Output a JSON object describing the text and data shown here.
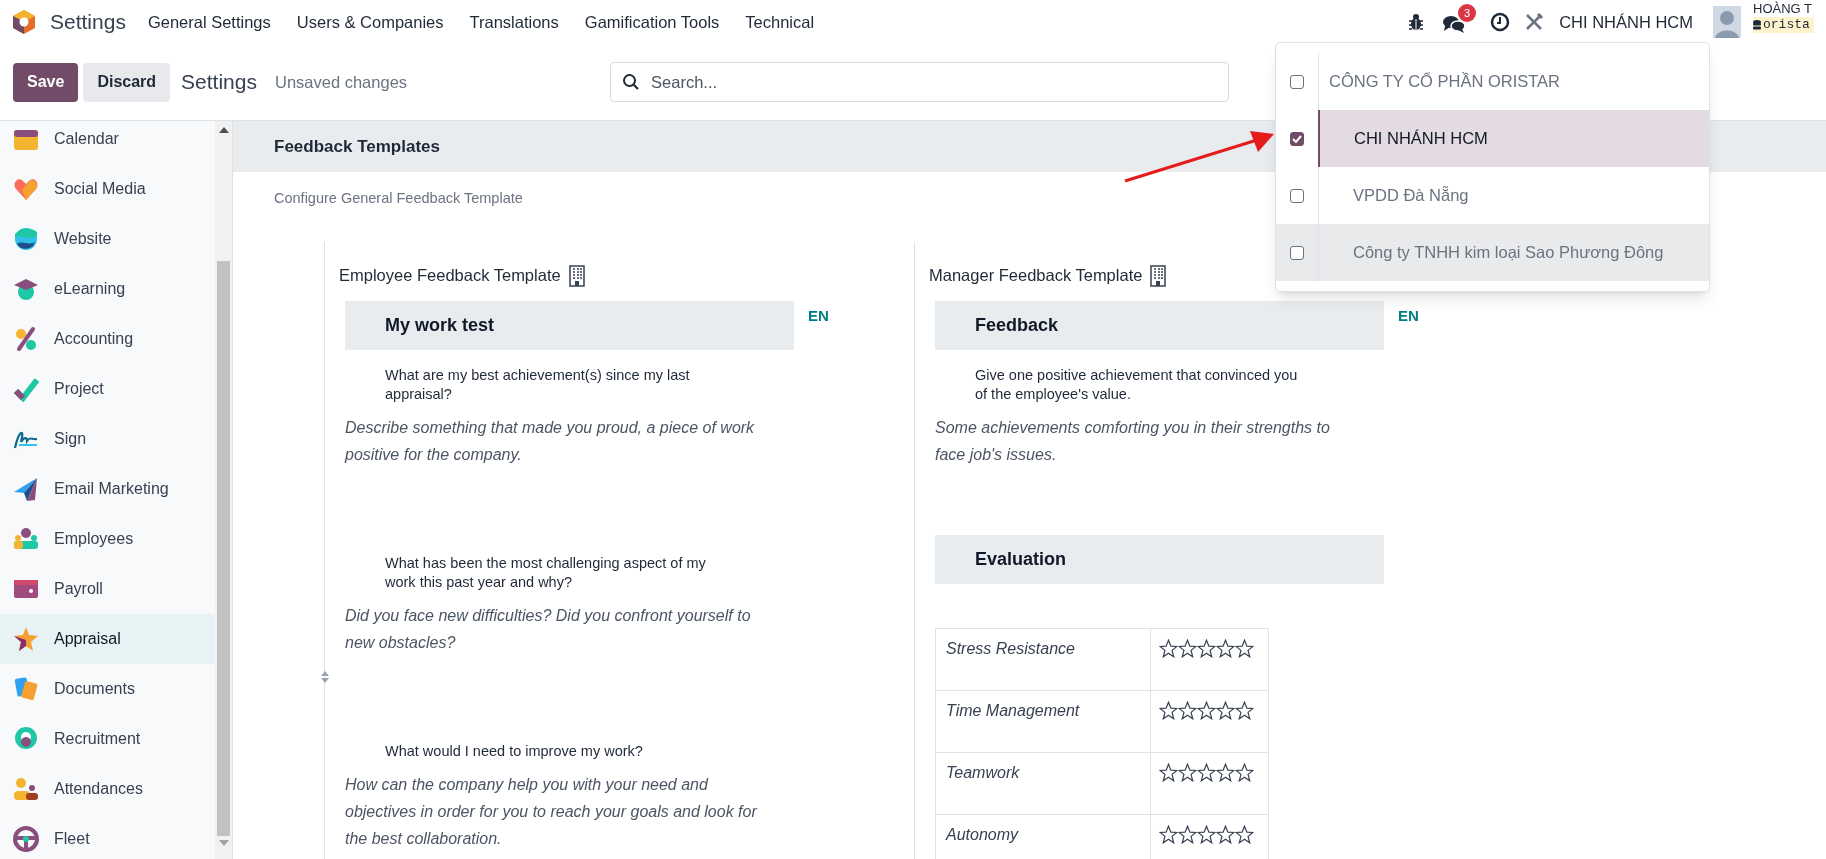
{
  "navbar": {
    "app_title": "Settings",
    "menu": [
      "General Settings",
      "Users & Companies",
      "Translations",
      "Gamification Tools",
      "Technical"
    ],
    "systray": {
      "message_count": "3",
      "company": "CHI NHÁNH HCM",
      "user_name": "HOÀNG T",
      "database": "orista"
    }
  },
  "control_panel": {
    "buttons": [
      {
        "label": "Save",
        "kind": "primary"
      },
      {
        "label": "Discard",
        "kind": "secondary"
      }
    ],
    "title": "Settings",
    "status": "Unsaved changes",
    "search": {
      "placeholder": "Search..."
    }
  },
  "sidebar": {
    "items": [
      {
        "label": "Calendar",
        "selected": false
      },
      {
        "label": "Social Media",
        "selected": false
      },
      {
        "label": "Website",
        "selected": false
      },
      {
        "label": "eLearning",
        "selected": false
      },
      {
        "label": "Accounting",
        "selected": false
      },
      {
        "label": "Project",
        "selected": false
      },
      {
        "label": "Sign",
        "selected": false
      },
      {
        "label": "Email Marketing",
        "selected": false
      },
      {
        "label": "Employees",
        "selected": false
      },
      {
        "label": "Payroll",
        "selected": false
      },
      {
        "label": "Appraisal",
        "selected": true
      },
      {
        "label": "Documents",
        "selected": false
      },
      {
        "label": "Recruitment",
        "selected": false
      },
      {
        "label": "Attendances",
        "selected": false
      },
      {
        "label": "Fleet",
        "selected": false
      }
    ]
  },
  "section": {
    "title": "Feedback Templates",
    "subtitle": "Configure General Feedback Template",
    "templates": [
      {
        "title": "Employee Feedback Template",
        "language": "EN",
        "blocks": [
          {
            "kind": "heading",
            "text": "My work test"
          },
          {
            "kind": "question",
            "text": "What are my best achievement(s) since my last appraisal?"
          },
          {
            "kind": "answer",
            "text": "Describe something that made you proud, a piece of work positive for the company."
          },
          {
            "kind": "question",
            "text": "What has been the most challenging aspect of my work this past year and why?"
          },
          {
            "kind": "answer",
            "text": "Did you face new difficulties? Did you confront yourself to new obstacles?"
          },
          {
            "kind": "question",
            "text": "What would I need to improve my work?"
          },
          {
            "kind": "answer",
            "text": "How can the company help you with your need and objectives in order for you to reach your goals and look for the best collaboration."
          }
        ]
      },
      {
        "title": "Manager Feedback Template",
        "language": "EN",
        "blocks": [
          {
            "kind": "heading",
            "text": "Feedback"
          },
          {
            "kind": "question",
            "text": "Give one positive achievement that convinced you of the employee's value."
          },
          {
            "kind": "answer",
            "text": "Some achievements comforting you in their strengths to face job's issues."
          },
          {
            "kind": "heading",
            "text": "Evaluation"
          },
          {
            "kind": "table",
            "rows": [
              {
                "label": "Stress Resistance",
                "stars": 0
              },
              {
                "label": "Time Management",
                "stars": 0
              },
              {
                "label": "Teamwork",
                "stars": 0
              },
              {
                "label": "Autonomy",
                "stars": 0
              }
            ]
          }
        ]
      }
    ]
  },
  "company_switcher": {
    "companies": [
      {
        "name": "CÔNG TY CỔ PHẦN ORISTAR",
        "checked": false,
        "selected": false,
        "hovered": false,
        "children": [
          {
            "name": "CHI NHÁNH HCM",
            "checked": true,
            "selected": true,
            "hovered": false
          },
          {
            "name": "VPDD Đà Nẵng",
            "checked": false,
            "selected": false,
            "hovered": false
          },
          {
            "name": "Công ty TNHH kim loại Sao Phương Đông",
            "checked": false,
            "selected": false,
            "hovered": true
          }
        ]
      }
    ]
  }
}
